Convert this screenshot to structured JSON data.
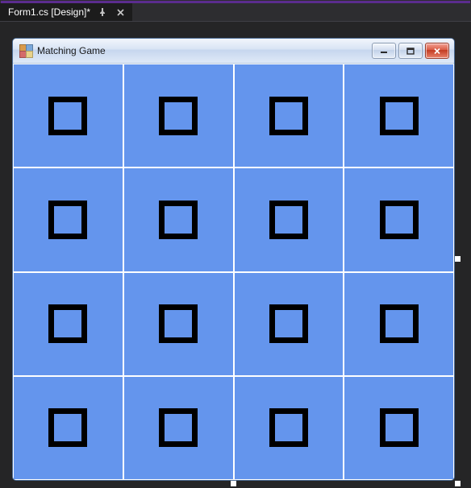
{
  "ide": {
    "tab": {
      "label": "Form1.cs [Design]*"
    }
  },
  "form": {
    "title": "Matching Game",
    "window_buttons": {
      "minimize": "minimize",
      "maximize": "maximize",
      "close": "close"
    }
  },
  "grid": {
    "rows": 4,
    "cols": 4,
    "cells": [
      {
        "glyph": "square"
      },
      {
        "glyph": "square"
      },
      {
        "glyph": "square"
      },
      {
        "glyph": "square"
      },
      {
        "glyph": "square"
      },
      {
        "glyph": "square"
      },
      {
        "glyph": "square"
      },
      {
        "glyph": "square"
      },
      {
        "glyph": "square"
      },
      {
        "glyph": "square"
      },
      {
        "glyph": "square"
      },
      {
        "glyph": "square"
      },
      {
        "glyph": "square"
      },
      {
        "glyph": "square"
      },
      {
        "glyph": "square"
      },
      {
        "glyph": "square"
      }
    ]
  },
  "colors": {
    "grid_background": "#6495ED",
    "glyph_color": "#000000"
  }
}
